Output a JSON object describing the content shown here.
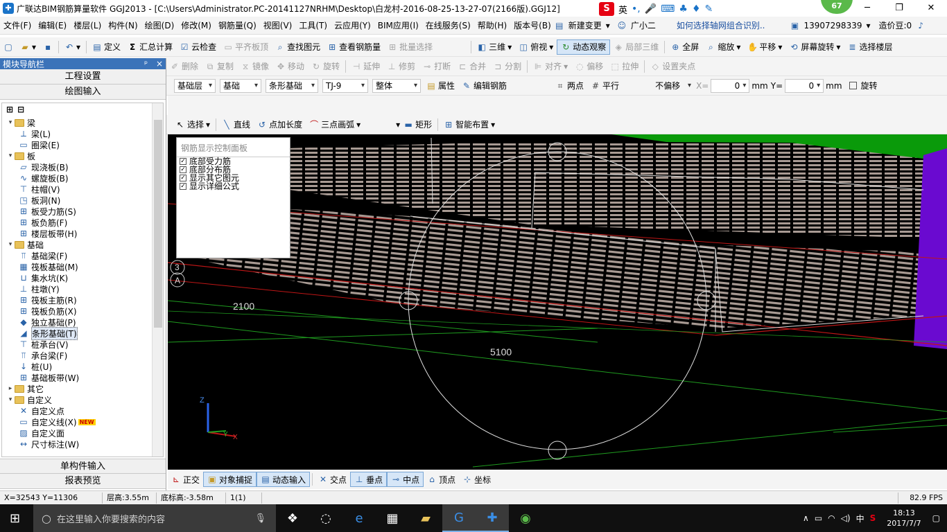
{
  "window": {
    "title": "广联达BIM钢筋算量软件 GGJ2013 - [C:\\Users\\Administrator.PC-20141127NRHM\\Desktop\\白龙村-2016-08-25-13-27-07(2166版).GGJ12]",
    "ime_label": "英",
    "badge_value": "67",
    "minimize": "─",
    "maximize": "❐",
    "close": "✕"
  },
  "menubar": {
    "items": [
      "文件(F)",
      "编辑(E)",
      "楼层(L)",
      "构件(N)",
      "绘图(D)",
      "修改(M)",
      "钢筋量(Q)",
      "视图(V)",
      "工具(T)",
      "云应用(Y)",
      "BIM应用(I)",
      "在线服务(S)",
      "帮助(H)",
      "版本号(B)"
    ],
    "new_change": "新建变更",
    "assistant": "广小二",
    "help_link": "如何选择轴网组合识别..",
    "phone": "13907298339",
    "price_bean": "造价豆:0"
  },
  "toolbar1": {
    "define": "定义",
    "summary_calc": "汇总计算",
    "cloud_check": "云检查",
    "flush_slab": "平齐板顶",
    "find_element": "查找图元",
    "view_rebar": "查看钢筋量",
    "batch_select": "批量选择",
    "three_d": "三维",
    "top_view": "俯视",
    "dynamic_view": "动态观察",
    "local_3d": "局部三维",
    "fullscreen": "全屏",
    "zoom": "缩放",
    "pan": "平移",
    "screen_rotate": "屏幕旋转",
    "select_floor": "选择楼层"
  },
  "toolbar2": {
    "delete": "删除",
    "copy": "复制",
    "mirror": "镜像",
    "move": "移动",
    "rotate": "旋转",
    "extend": "延伸",
    "trim": "修剪",
    "break": "打断",
    "merge": "合并",
    "split": "分割",
    "align": "对齐",
    "offset": "偏移",
    "stretch": "拉伸",
    "set_grip": "设置夹点"
  },
  "toolbar3": {
    "floor": "基础层",
    "category": "基础",
    "type": "条形基础",
    "element": "TJ-9",
    "whole": "整体",
    "property": "属性",
    "edit_rebar": "编辑钢筋",
    "two_point": "两点",
    "parallel": "平行",
    "offset_mode": "不偏移",
    "x_label": "X=",
    "x_value": "0",
    "y_label": "Y=",
    "y_value": "0",
    "unit": "mm",
    "rotate": "旋转"
  },
  "toolbar4": {
    "select": "选择",
    "line": "直线",
    "point_length": "点加长度",
    "three_arc": "三点画弧",
    "rect": "矩形",
    "smart_place": "智能布置"
  },
  "left_panel": {
    "header": "模块导航栏",
    "pin": "ᵖ",
    "close": "×",
    "project_settings": "工程设置",
    "drawing_input": "绘图输入",
    "single_input": "单构件输入",
    "report_preview": "报表预览",
    "tree": [
      {
        "level": 0,
        "kind": "folder",
        "label": "梁",
        "exp": "▾"
      },
      {
        "level": 1,
        "kind": "item",
        "label": "梁(L)",
        "icon": "beam-icon",
        "glyph": "⟂"
      },
      {
        "level": 1,
        "kind": "item",
        "label": "圈梁(E)",
        "icon": "ring-beam-icon",
        "glyph": "▭"
      },
      {
        "level": 0,
        "kind": "folder",
        "label": "板",
        "exp": "▾"
      },
      {
        "level": 1,
        "kind": "item",
        "label": "现浇板(B)",
        "icon": "cast-slab-icon",
        "glyph": "▱"
      },
      {
        "level": 1,
        "kind": "item",
        "label": "螺旋板(B)",
        "icon": "spiral-slab-icon",
        "glyph": "∿"
      },
      {
        "level": 1,
        "kind": "item",
        "label": "柱帽(V)",
        "icon": "column-cap-icon",
        "glyph": "⊤"
      },
      {
        "level": 1,
        "kind": "item",
        "label": "板洞(N)",
        "icon": "slab-hole-icon",
        "glyph": "◳"
      },
      {
        "level": 1,
        "kind": "item",
        "label": "板受力筋(S)",
        "icon": "slab-rebar-icon",
        "glyph": "⊞"
      },
      {
        "level": 1,
        "kind": "item",
        "label": "板负筋(F)",
        "icon": "slab-neg-rebar-icon",
        "glyph": "⊞"
      },
      {
        "level": 1,
        "kind": "item",
        "label": "楼层板带(H)",
        "icon": "floor-strip-icon",
        "glyph": "⊞"
      },
      {
        "level": 0,
        "kind": "folder",
        "label": "基础",
        "exp": "▾"
      },
      {
        "level": 1,
        "kind": "item",
        "label": "基础梁(F)",
        "icon": "foundation-beam-icon",
        "glyph": "⫪"
      },
      {
        "level": 1,
        "kind": "item",
        "label": "筏板基础(M)",
        "icon": "raft-foundation-icon",
        "glyph": "▦"
      },
      {
        "level": 1,
        "kind": "item",
        "label": "集水坑(K)",
        "icon": "sump-icon",
        "glyph": "⊔"
      },
      {
        "level": 1,
        "kind": "item",
        "label": "柱墩(Y)",
        "icon": "column-pier-icon",
        "glyph": "⊥"
      },
      {
        "level": 1,
        "kind": "item",
        "label": "筏板主筋(R)",
        "icon": "raft-main-rebar-icon",
        "glyph": "⊞"
      },
      {
        "level": 1,
        "kind": "item",
        "label": "筏板负筋(X)",
        "icon": "raft-neg-rebar-icon",
        "glyph": "⊞"
      },
      {
        "level": 1,
        "kind": "item",
        "label": "独立基础(P)",
        "icon": "isolated-foundation-icon",
        "glyph": "◆"
      },
      {
        "level": 1,
        "kind": "item",
        "label": "条形基础(T)",
        "icon": "strip-foundation-icon",
        "glyph": "◢",
        "selected": true
      },
      {
        "level": 1,
        "kind": "item",
        "label": "桩承台(V)",
        "icon": "pile-cap-icon",
        "glyph": "⊤"
      },
      {
        "level": 1,
        "kind": "item",
        "label": "承台梁(F)",
        "icon": "cap-beam-icon",
        "glyph": "⫪"
      },
      {
        "level": 1,
        "kind": "item",
        "label": "桩(U)",
        "icon": "pile-icon",
        "glyph": "↓"
      },
      {
        "level": 1,
        "kind": "item",
        "label": "基础板带(W)",
        "icon": "foundation-strip-icon",
        "glyph": "⊞"
      },
      {
        "level": 0,
        "kind": "folder",
        "label": "其它",
        "exp": "▸"
      },
      {
        "level": 0,
        "kind": "folder",
        "label": "自定义",
        "exp": "▾"
      },
      {
        "level": 1,
        "kind": "item",
        "label": "自定义点",
        "icon": "custom-point-icon",
        "glyph": "✕"
      },
      {
        "level": 1,
        "kind": "item",
        "label": "自定义线(X)",
        "icon": "custom-line-icon",
        "glyph": "▭",
        "new": "NEW"
      },
      {
        "level": 1,
        "kind": "item",
        "label": "自定义面",
        "icon": "custom-face-icon",
        "glyph": "▨"
      },
      {
        "level": 1,
        "kind": "item",
        "label": "尺寸标注(W)",
        "icon": "dimension-icon",
        "glyph": "↔"
      }
    ]
  },
  "viewport": {
    "panel_title": "钢筋显示控制面板",
    "checkboxes": [
      "底部受力筋",
      "底部分布筋",
      "显示其它图元",
      "显示详细公式"
    ],
    "dim1": "2100",
    "dim2": "5100",
    "axis_3": "3",
    "axis_a": "A",
    "z_axis": "Z",
    "y_axis": "Y",
    "x_axis": "X"
  },
  "snapbar": {
    "orthogonal": "正交",
    "object_snap": "对象捕捉",
    "dynamic_input": "动态输入",
    "intersection": "交点",
    "perpendicular": "垂点",
    "midpoint": "中点",
    "vertex": "顶点",
    "coordinate": "坐标"
  },
  "statusbar": {
    "coords": "X=32543 Y=11306",
    "floor_height": "层高:3.55m",
    "base_elevation": "底标高:-3.58m",
    "count": "1(1)",
    "fps": "82.9 FPS"
  },
  "taskbar": {
    "search_placeholder": "在这里输入你要搜索的内容",
    "lang": "中",
    "time": "18:13",
    "date": "2017/7/7"
  },
  "colors": {
    "accent": "#3b73b9",
    "viewport_bg": "#000000",
    "grid_green": "#1f9c1f",
    "grid_red": "#c01616",
    "rebar_fill": "#a89a93",
    "purple_wall": "#6a0ad0"
  }
}
